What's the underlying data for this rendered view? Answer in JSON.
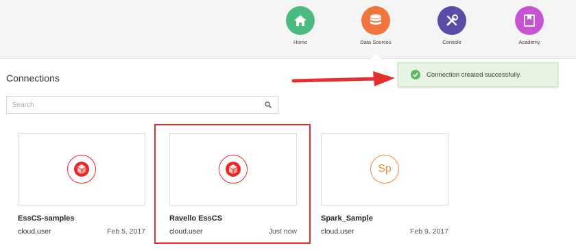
{
  "nav": {
    "items": [
      {
        "label": "Home",
        "icon": "home-icon",
        "color": "#4cbb7f"
      },
      {
        "label": "Data Sources",
        "icon": "database-icon",
        "color": "#f0763e"
      },
      {
        "label": "Console",
        "icon": "tools-icon",
        "color": "#5b4ba6"
      },
      {
        "label": "Academy",
        "icon": "academy-icon",
        "color": "#c752d2"
      }
    ],
    "active": "Data Sources"
  },
  "page": {
    "title": "Connections"
  },
  "search": {
    "placeholder": "Search",
    "value": ""
  },
  "toast": {
    "message": "Connection created successfully.",
    "status": "success",
    "color": "#5cb85c"
  },
  "connections": [
    {
      "name": "EssCS-samples",
      "owner": "cloud.user",
      "date": "Feb 5, 2017",
      "logo": "cube-icon",
      "logo_color": "#e8282b"
    },
    {
      "name": "Ravello EssCS",
      "owner": "cloud.user",
      "date": "Just now",
      "logo": "cube-icon",
      "logo_color": "#e8282b",
      "highlighted": true
    },
    {
      "name": "Spark_Sample",
      "owner": "cloud.user",
      "date": "Feb 9, 2017",
      "logo": "spark-icon",
      "logo_text": "Sp",
      "logo_color": "#f0883c"
    }
  ],
  "annotation": {
    "color": "#e3302f"
  }
}
